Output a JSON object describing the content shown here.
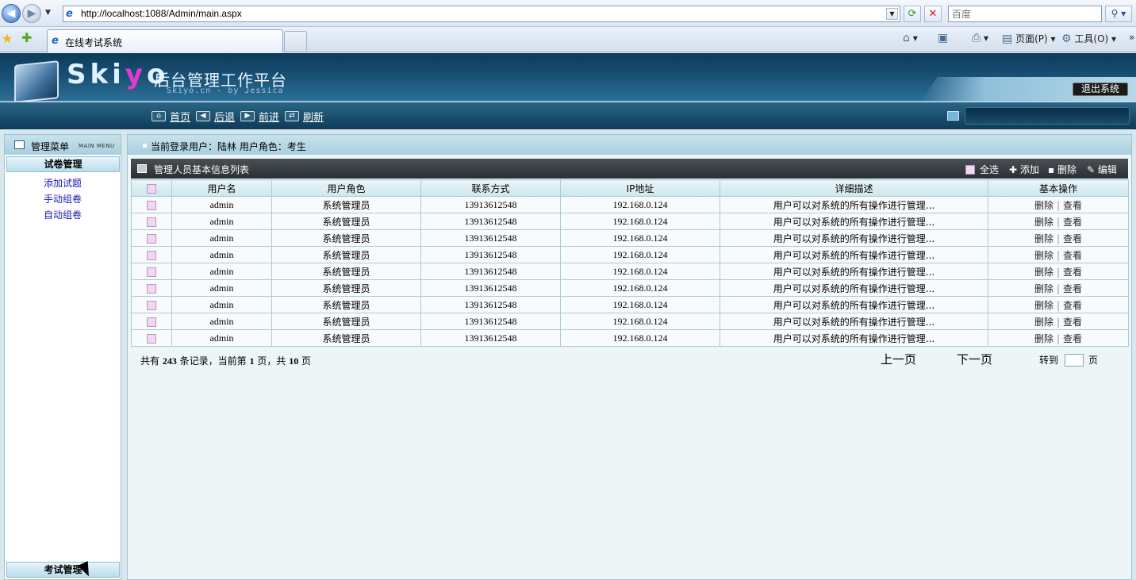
{
  "browser": {
    "url": "http://localhost:1088/Admin/main.aspx",
    "search_placeholder": "百度",
    "tab_title": "在线考试系统",
    "commands": {
      "page": "页面(P)",
      "tools": "工具(O)"
    }
  },
  "header": {
    "logo": "Skiyo",
    "title": "后台管理工作平台",
    "subtitle": "Skiyo.cn - by Jessica",
    "logout": "退出系统",
    "nav": [
      {
        "label": "首页",
        "icon": "home-icon"
      },
      {
        "label": "后退",
        "icon": "back-arrow-icon"
      },
      {
        "label": "前进",
        "icon": "forward-arrow-icon"
      },
      {
        "label": "刷新",
        "icon": "refresh-icon"
      }
    ]
  },
  "sidebar": {
    "title": "管理菜单",
    "title_en": "MAIN MENU",
    "sections": [
      {
        "label": "试卷管理",
        "items": [
          "添加试题",
          "手动组卷",
          "自动组卷"
        ]
      },
      {
        "label": "考试管理",
        "items": []
      }
    ]
  },
  "main": {
    "user_info": "当前登录用户：陆林   用户角色：考生",
    "list_title": "管理人员基本信息列表",
    "toolbar": {
      "select_all": "全选",
      "add": "✚ 添加",
      "delete": "▪ 删除",
      "edit": "✎ 编辑"
    },
    "columns": [
      "",
      "用户名",
      "用户角色",
      "联系方式",
      "IP地址",
      "详细描述",
      "基本操作"
    ],
    "row_actions": {
      "delete": "删除",
      "view": "查看"
    },
    "rows": [
      {
        "username": "admin",
        "role": "系统管理员",
        "contact": "13913612548",
        "ip": "192.168.0.124",
        "desc": "用户可以对系统的所有操作进行管理..."
      },
      {
        "username": "admin",
        "role": "系统管理员",
        "contact": "13913612548",
        "ip": "192.168.0.124",
        "desc": "用户可以对系统的所有操作进行管理..."
      },
      {
        "username": "admin",
        "role": "系统管理员",
        "contact": "13913612548",
        "ip": "192.168.0.124",
        "desc": "用户可以对系统的所有操作进行管理..."
      },
      {
        "username": "admin",
        "role": "系统管理员",
        "contact": "13913612548",
        "ip": "192.168.0.124",
        "desc": "用户可以对系统的所有操作进行管理..."
      },
      {
        "username": "admin",
        "role": "系统管理员",
        "contact": "13913612548",
        "ip": "192.168.0.124",
        "desc": "用户可以对系统的所有操作进行管理..."
      },
      {
        "username": "admin",
        "role": "系统管理员",
        "contact": "13913612548",
        "ip": "192.168.0.124",
        "desc": "用户可以对系统的所有操作进行管理..."
      },
      {
        "username": "admin",
        "role": "系统管理员",
        "contact": "13913612548",
        "ip": "192.168.0.124",
        "desc": "用户可以对系统的所有操作进行管理..."
      },
      {
        "username": "admin",
        "role": "系统管理员",
        "contact": "13913612548",
        "ip": "192.168.0.124",
        "desc": "用户可以对系统的所有操作进行管理..."
      },
      {
        "username": "admin",
        "role": "系统管理员",
        "contact": "13913612548",
        "ip": "192.168.0.124",
        "desc": "用户可以对系统的所有操作进行管理..."
      }
    ],
    "pager": {
      "total_prefix": "共有",
      "total": "243",
      "total_suffix": "条记录，当前第",
      "current": "1",
      "page_mid": "页，共",
      "pages": "10",
      "page_end": "页",
      "prev": "上一页",
      "next": "下一页",
      "goto": "转到",
      "goto_suffix": "页"
    }
  }
}
